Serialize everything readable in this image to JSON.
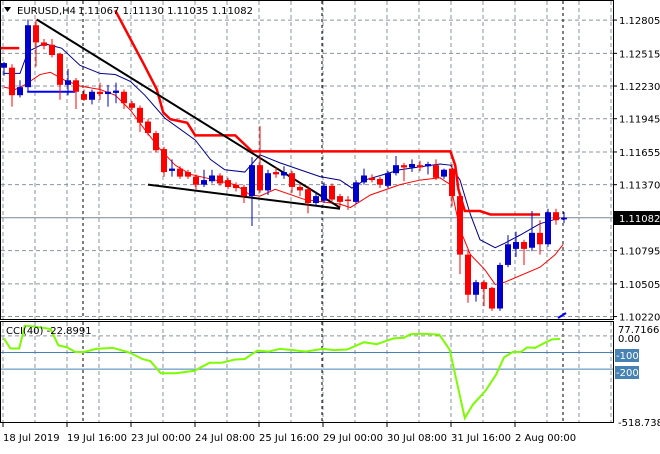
{
  "header": {
    "symbol": "EURUSD,H4",
    "ohlc": "1.11067 1.11130 1.11035 1.11082",
    "menu_icon": "triangle-down-icon"
  },
  "price_axis": {
    "ticks": [
      "1.12805",
      "1.12515",
      "1.12230",
      "1.11945",
      "1.11655",
      "1.11370",
      "1.10795",
      "1.10505",
      "1.10220"
    ],
    "tick_values": [
      1.12805,
      1.12515,
      1.1223,
      1.11945,
      1.11655,
      1.1137,
      1.10795,
      1.10505,
      1.1022
    ],
    "current_price": "1.11082",
    "current_value": 1.11082
  },
  "time_axis": {
    "labels": [
      "18 Jul 2019",
      "19 Jul 16:00",
      "23 Jul 00:00",
      "24 Jul 08:00",
      "25 Jul 16:00",
      "29 Jul 00:00",
      "30 Jul 08:00",
      "31 Jul 16:00",
      "2 Aug 00:00"
    ],
    "label_bars": [
      0,
      8,
      16,
      24,
      32,
      40,
      48,
      56,
      64
    ]
  },
  "cci": {
    "label": "CCI(40) -22.8991",
    "axis_max": "77.7166",
    "axis_zero": "0.00",
    "level_1": "-100",
    "level_2": "-200",
    "axis_min": "-518.738"
  },
  "colors": {
    "bull": "#0000cc",
    "bear": "#ff0000",
    "slow_ma": "#00008b",
    "fast_ma": "#ff0000",
    "cci_line": "#7cfc00",
    "cci_levels": "#4682b4",
    "trendline": "#000000"
  },
  "chart_data": [
    {
      "type": "candlestick",
      "title": "EURUSD,H4",
      "ylim": [
        1.1019,
        1.1298
      ],
      "y_ticks": [
        1.12805,
        1.12515,
        1.1223,
        1.11945,
        1.11655,
        1.1137,
        1.11082,
        1.10795,
        1.10505,
        1.1022
      ],
      "ohlc": [
        [
          1.1239,
          1.1244,
          1.1232,
          1.1243
        ],
        [
          1.1239,
          1.1242,
          1.1205,
          1.1215
        ],
        [
          1.1215,
          1.1228,
          1.1213,
          1.1222
        ],
        [
          1.1222,
          1.1281,
          1.1218,
          1.1276
        ],
        [
          1.1276,
          1.1281,
          1.124,
          1.1261
        ],
        [
          1.1261,
          1.1264,
          1.1255,
          1.1258
        ],
        [
          1.1259,
          1.1264,
          1.1248,
          1.125
        ],
        [
          1.1251,
          1.1252,
          1.1211,
          1.1224
        ],
        [
          1.1224,
          1.1238,
          1.1215,
          1.1228
        ],
        [
          1.1228,
          1.123,
          1.1203,
          1.1218
        ],
        [
          1.1216,
          1.122,
          1.121,
          1.1211
        ],
        [
          1.1211,
          1.122,
          1.1207,
          1.1218
        ],
        [
          1.1218,
          1.1226,
          1.1211,
          1.1216
        ],
        [
          1.1216,
          1.1224,
          1.1205,
          1.1218
        ],
        [
          1.1217,
          1.1226,
          1.1208,
          1.1219
        ],
        [
          1.1218,
          1.122,
          1.1203,
          1.1208
        ],
        [
          1.1208,
          1.121,
          1.1202,
          1.1204
        ],
        [
          1.1204,
          1.1206,
          1.1183,
          1.1191
        ],
        [
          1.1192,
          1.1194,
          1.118,
          1.1182
        ],
        [
          1.1182,
          1.1184,
          1.1165,
          1.1167
        ],
        [
          1.1168,
          1.117,
          1.1144,
          1.1148
        ],
        [
          1.1149,
          1.1159,
          1.1144,
          1.1151
        ],
        [
          1.1151,
          1.1153,
          1.1142,
          1.1144
        ],
        [
          1.1148,
          1.115,
          1.1142,
          1.1144
        ],
        [
          1.1144,
          1.1146,
          1.1133,
          1.1137
        ],
        [
          1.1137,
          1.115,
          1.1135,
          1.1141
        ],
        [
          1.114,
          1.115,
          1.1138,
          1.1145
        ],
        [
          1.1145,
          1.1147,
          1.1136,
          1.1138
        ],
        [
          1.1141,
          1.1143,
          1.1133,
          1.1135
        ],
        [
          1.1137,
          1.1139,
          1.1131,
          1.1134
        ],
        [
          1.1135,
          1.1137,
          1.1121,
          1.1127
        ],
        [
          1.1127,
          1.1161,
          1.1101,
          1.1154
        ],
        [
          1.1154,
          1.1188,
          1.113,
          1.1132
        ],
        [
          1.1132,
          1.115,
          1.1128,
          1.1147
        ],
        [
          1.1148,
          1.1152,
          1.1143,
          1.1146
        ],
        [
          1.1145,
          1.1153,
          1.1142,
          1.1148
        ],
        [
          1.1147,
          1.1149,
          1.113,
          1.1135
        ],
        [
          1.1135,
          1.1138,
          1.1127,
          1.1132
        ],
        [
          1.1133,
          1.1136,
          1.1112,
          1.1121
        ],
        [
          1.1121,
          1.1131,
          1.1118,
          1.1127
        ],
        [
          1.1123,
          1.1139,
          1.1121,
          1.1136
        ],
        [
          1.1136,
          1.1138,
          1.1121,
          1.1124
        ],
        [
          1.1127,
          1.1129,
          1.1117,
          1.1122
        ],
        [
          1.1124,
          1.1127,
          1.1115,
          1.1123
        ],
        [
          1.1122,
          1.1141,
          1.112,
          1.1139
        ],
        [
          1.1139,
          1.1151,
          1.1137,
          1.1145
        ],
        [
          1.1143,
          1.1146,
          1.1139,
          1.1141
        ],
        [
          1.1142,
          1.1144,
          1.1134,
          1.1137
        ],
        [
          1.1136,
          1.1149,
          1.1134,
          1.1147
        ],
        [
          1.1147,
          1.1162,
          1.1145,
          1.1154
        ],
        [
          1.1154,
          1.1156,
          1.114,
          1.1152
        ],
        [
          1.1152,
          1.1159,
          1.1148,
          1.1155
        ],
        [
          1.1154,
          1.1158,
          1.1149,
          1.1152
        ],
        [
          1.1153,
          1.1157,
          1.1146,
          1.1155
        ],
        [
          1.1154,
          1.1159,
          1.1141,
          1.1143
        ],
        [
          1.1144,
          1.1151,
          1.1142,
          1.115
        ],
        [
          1.1151,
          1.1155,
          1.1118,
          1.1127
        ],
        [
          1.1127,
          1.113,
          1.1059,
          1.1076
        ],
        [
          1.1076,
          1.1081,
          1.1034,
          1.1041
        ],
        [
          1.1041,
          1.1054,
          1.1035,
          1.1052
        ],
        [
          1.1052,
          1.1054,
          1.1031,
          1.1046
        ],
        [
          1.1047,
          1.1048,
          1.1027,
          1.1029
        ],
        [
          1.1029,
          1.1069,
          1.1027,
          1.1067
        ],
        [
          1.1067,
          1.1093,
          1.1065,
          1.1085
        ],
        [
          1.1081,
          1.1096,
          1.1074,
          1.1087
        ],
        [
          1.1087,
          1.1089,
          1.1067,
          1.1081
        ],
        [
          1.1082,
          1.1114,
          1.1079,
          1.1095
        ],
        [
          1.1095,
          1.1106,
          1.1076,
          1.1085
        ],
        [
          1.1085,
          1.1116,
          1.1083,
          1.1113
        ],
        [
          1.1113,
          1.1116,
          1.1102,
          1.1106
        ],
        [
          1.11067,
          1.1113,
          1.11035,
          1.11082
        ]
      ],
      "overlays": {
        "slow_ma": [
          [
            0,
            1.1234
          ],
          [
            2,
            1.1234
          ],
          [
            3,
            1.1253
          ],
          [
            5,
            1.126
          ],
          [
            7.2,
            1.1256
          ],
          [
            9.5,
            1.1241
          ],
          [
            12,
            1.1234
          ],
          [
            13.9,
            1.1233
          ],
          [
            15.8,
            1.1227
          ],
          [
            17.6,
            1.1215
          ],
          [
            20.1,
            1.1195
          ],
          [
            23.9,
            1.1176
          ],
          [
            25.8,
            1.1159
          ],
          [
            27.6,
            1.115
          ],
          [
            30.1,
            1.1148
          ],
          [
            32,
            1.1163
          ],
          [
            34.5,
            1.1156
          ],
          [
            39.5,
            1.1144
          ],
          [
            42,
            1.1141
          ],
          [
            43.5,
            1.1134
          ],
          [
            45.1,
            1.1141
          ],
          [
            49.5,
            1.115
          ],
          [
            54.5,
            1.1155
          ],
          [
            55.8,
            1.1154
          ],
          [
            57,
            1.1141
          ],
          [
            58.3,
            1.1111
          ],
          [
            59.5,
            1.1089
          ],
          [
            61.4,
            1.1082
          ],
          [
            62.6,
            1.1086
          ],
          [
            64.5,
            1.1093
          ],
          [
            67,
            1.1103
          ],
          [
            69.5,
            1.1108
          ]
        ],
        "fast_ma": [
          [
            0,
            1.1222
          ],
          [
            1.4,
            1.122
          ],
          [
            2.6,
            1.1224
          ],
          [
            4.5,
            1.1233
          ],
          [
            5.8,
            1.1235
          ],
          [
            7.6,
            1.1228
          ],
          [
            9.5,
            1.1223
          ],
          [
            12,
            1.122
          ],
          [
            13.9,
            1.1215
          ],
          [
            15.8,
            1.1202
          ],
          [
            17.6,
            1.1185
          ],
          [
            19.5,
            1.1168
          ],
          [
            21.4,
            1.1154
          ],
          [
            23.3,
            1.1146
          ],
          [
            26.4,
            1.1141
          ],
          [
            28.9,
            1.1137
          ],
          [
            30.8,
            1.1128
          ],
          [
            32,
            1.1127
          ],
          [
            33.9,
            1.1133
          ],
          [
            37.6,
            1.1124
          ],
          [
            42,
            1.112
          ],
          [
            43.3,
            1.1117
          ],
          [
            45.8,
            1.1128
          ],
          [
            49.5,
            1.1137
          ],
          [
            52,
            1.1141
          ],
          [
            54.5,
            1.1143
          ],
          [
            55.8,
            1.1137
          ],
          [
            57,
            1.1098
          ],
          [
            58.3,
            1.1076
          ],
          [
            60.1,
            1.1063
          ],
          [
            61.4,
            1.105
          ],
          [
            62.6,
            1.1052
          ],
          [
            67,
            1.1065
          ],
          [
            68.9,
            1.1076
          ],
          [
            69.9,
            1.1085
          ]
        ],
        "resistance_step_a": [
          [
            -0.5,
            1.1256
          ],
          [
            1.9,
            1.1256
          ]
        ],
        "resistance_step_b": [
          [
            13.9,
            1.1289
          ],
          [
            17.4,
            1.1243
          ],
          [
            19.1,
            1.122
          ],
          [
            19.9,
            1.12
          ],
          [
            20.8,
            1.1194
          ],
          [
            22.9,
            1.1191
          ],
          [
            23.9,
            1.118
          ],
          [
            28.9,
            1.118
          ],
          [
            31,
            1.1166
          ],
          [
            55.8,
            1.1166
          ],
          [
            56.4,
            1.1154
          ],
          [
            56.8,
            1.1133
          ],
          [
            57.6,
            1.1114
          ],
          [
            59.5,
            1.1114
          ],
          [
            60.8,
            1.1111
          ],
          [
            67,
            1.1111
          ]
        ],
        "support_segment": [
          [
            2.9,
            1.1218
          ],
          [
            8.9,
            1.1218
          ]
        ],
        "trendline_upper": [
          [
            4.1,
            1.1281
          ],
          [
            42,
            1.1117
          ]
        ],
        "trendline_lower": [
          [
            18,
            1.1137
          ],
          [
            42,
            1.1116
          ]
        ]
      }
    },
    {
      "type": "line",
      "title": "CCI(40)",
      "ylim": [
        -518.738,
        77.7166
      ],
      "levels": [
        0,
        -100,
        -200
      ],
      "points": [
        [
          0,
          -15
        ],
        [
          0.8,
          -76
        ],
        [
          1.9,
          -76
        ],
        [
          2.6,
          61
        ],
        [
          3.7,
          57
        ],
        [
          5.8,
          42
        ],
        [
          6.8,
          -57
        ],
        [
          7.9,
          -69
        ],
        [
          8.9,
          -97
        ],
        [
          10,
          -97
        ],
        [
          11.5,
          -78
        ],
        [
          13.6,
          -72
        ],
        [
          15.7,
          -101
        ],
        [
          17.3,
          -139
        ],
        [
          18.3,
          -152
        ],
        [
          19.6,
          -225
        ],
        [
          21.5,
          -225
        ],
        [
          23.8,
          -210
        ],
        [
          25.7,
          -162
        ],
        [
          27.2,
          -162
        ],
        [
          28.8,
          -143
        ],
        [
          30.1,
          -139
        ],
        [
          31.7,
          -88
        ],
        [
          33,
          -95
        ],
        [
          34.5,
          -78
        ],
        [
          36.1,
          -86
        ],
        [
          37.7,
          -95
        ],
        [
          39.8,
          -78
        ],
        [
          41.3,
          -86
        ],
        [
          42.9,
          -82
        ],
        [
          45,
          -38
        ],
        [
          46.6,
          -50
        ],
        [
          48.7,
          -15
        ],
        [
          50,
          -11
        ],
        [
          50.8,
          10
        ],
        [
          52.3,
          13
        ],
        [
          54.4,
          8
        ],
        [
          55.7,
          -82
        ],
        [
          57.6,
          -495
        ],
        [
          58.6,
          -415
        ],
        [
          60.2,
          -330
        ],
        [
          61.5,
          -234
        ],
        [
          62.5,
          -130
        ],
        [
          63.6,
          -97
        ],
        [
          64.6,
          -97
        ],
        [
          65.4,
          -69
        ],
        [
          66.4,
          -72
        ],
        [
          67.5,
          -44
        ],
        [
          68.5,
          -21
        ],
        [
          69.5,
          -19
        ]
      ]
    }
  ]
}
